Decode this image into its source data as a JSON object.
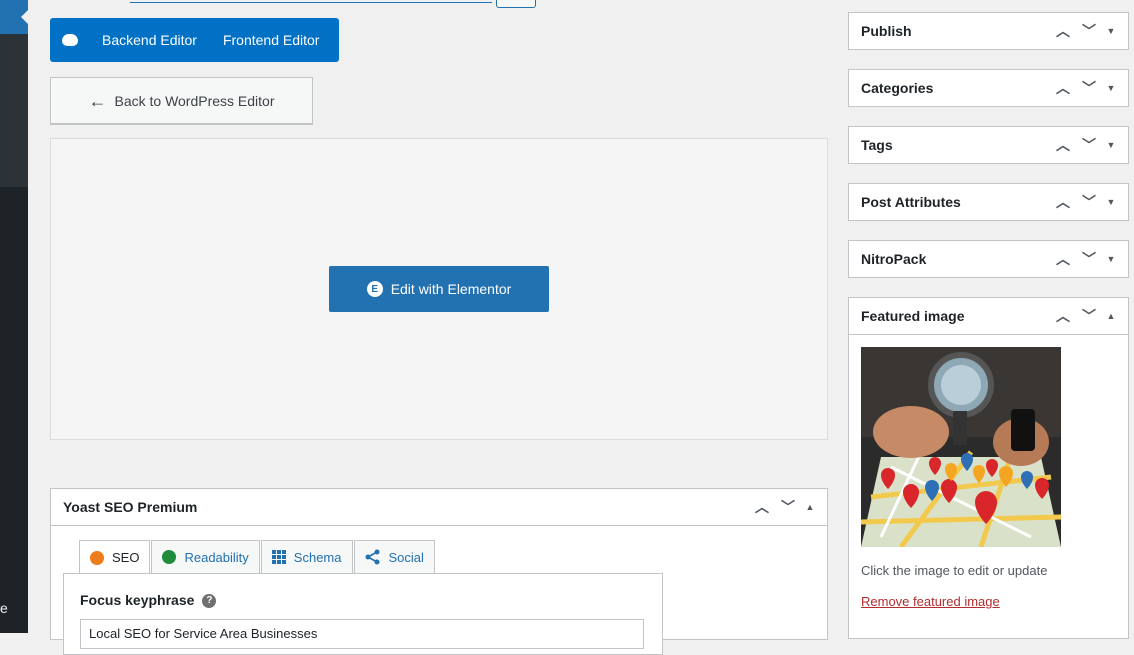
{
  "editor_switch": {
    "backend_label": "Backend Editor",
    "frontend_label": "Frontend Editor"
  },
  "back_button": {
    "label": "Back to WordPress Editor"
  },
  "elementor": {
    "button_label": "Edit with Elementor"
  },
  "sidebar": {
    "boxes": [
      {
        "title": "Publish"
      },
      {
        "title": "Categories"
      },
      {
        "title": "Tags"
      },
      {
        "title": "Post Attributes"
      },
      {
        "title": "NitroPack"
      }
    ],
    "featured_image": {
      "title": "Featured image",
      "note": "Click the image to edit or update",
      "remove_label": "Remove featured image"
    }
  },
  "yoast": {
    "title": "Yoast SEO Premium",
    "tabs": [
      {
        "label": "SEO"
      },
      {
        "label": "Readability"
      },
      {
        "label": "Schema"
      },
      {
        "label": "Social"
      }
    ],
    "focus_keyphrase_label": "Focus keyphrase",
    "focus_keyphrase_value": "Local SEO for Service Area Businesses"
  },
  "admin_menu": {
    "trail_text": "e"
  },
  "colors": {
    "accent": "#2271b1",
    "switch": "#0071c5",
    "danger": "#b32d2e",
    "seo_score": "#ee7c1b",
    "readability_score": "#1e8c3b"
  }
}
